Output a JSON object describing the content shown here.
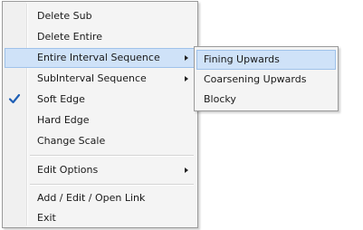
{
  "menu": {
    "items": [
      {
        "label": "Delete Sub"
      },
      {
        "label": "Delete Entire"
      },
      {
        "label": "Entire Interval Sequence"
      },
      {
        "label": "SubInterval Sequence"
      },
      {
        "label": "Soft Edge"
      },
      {
        "label": "Hard Edge"
      },
      {
        "label": "Change Scale"
      },
      {
        "label": "Edit Options"
      },
      {
        "label": "Add / Edit / Open Link"
      },
      {
        "label": "Exit"
      }
    ]
  },
  "submenu": {
    "items": [
      {
        "label": "Fining Upwards"
      },
      {
        "label": "Coarsening Upwards"
      },
      {
        "label": "Blocky"
      }
    ]
  },
  "colors": {
    "highlight": "#cfe2f8",
    "highlight_border": "#9fc2ea",
    "check": "#1f5fb5"
  },
  "icons": {
    "checkmark": "checkmark-icon",
    "submenu_arrow": "submenu-arrow-icon"
  }
}
